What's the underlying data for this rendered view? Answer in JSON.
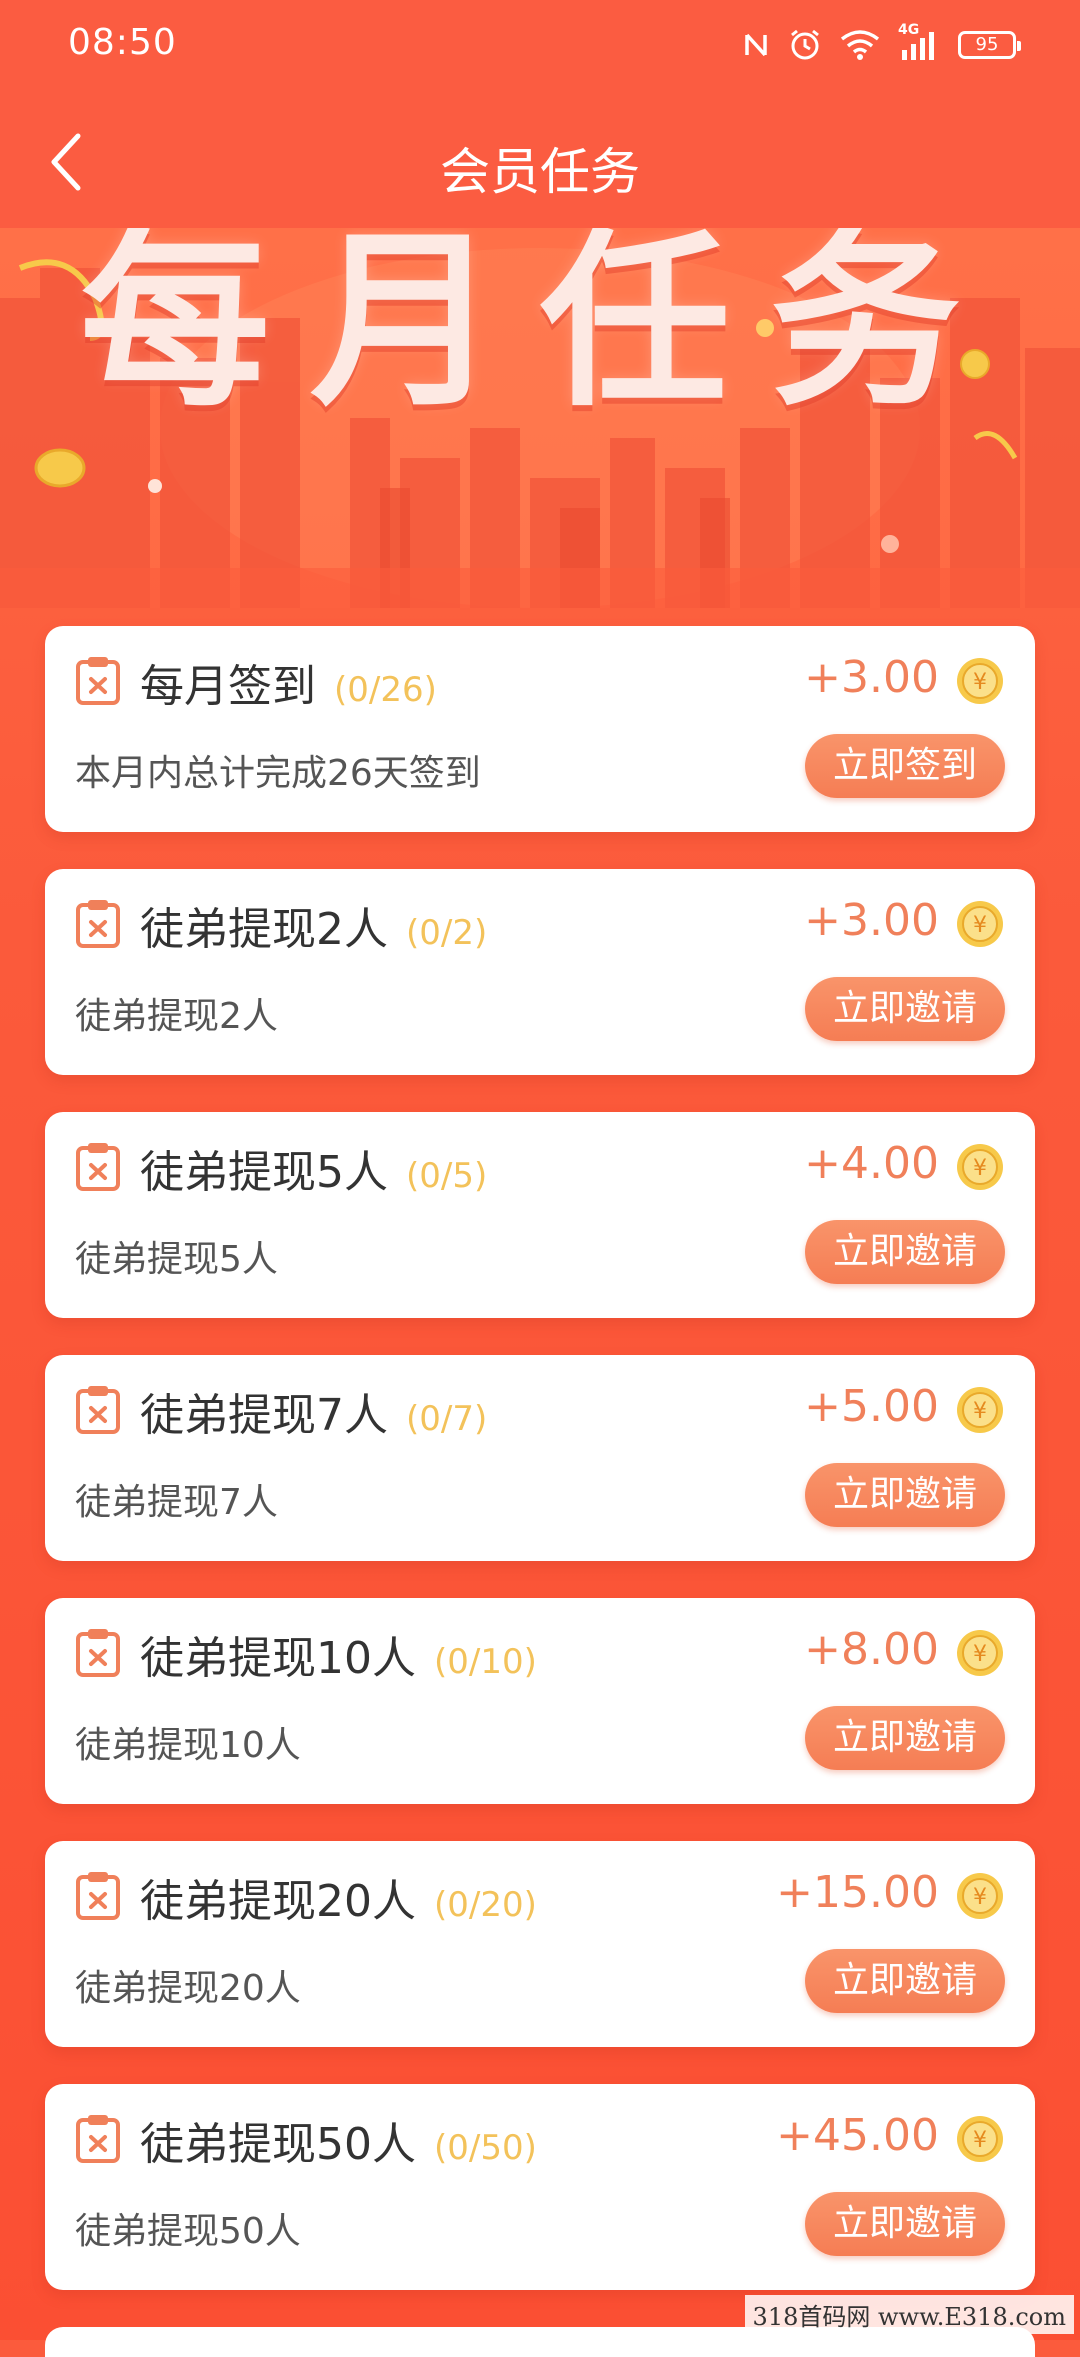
{
  "status_bar": {
    "time": "08:50",
    "network": "4G",
    "battery": "95",
    "icons": [
      "nfc-icon",
      "alarm-icon",
      "wifi-icon",
      "signal-icon",
      "battery-icon"
    ]
  },
  "nav": {
    "title": "会员任务",
    "back_icon": "chevron-left-icon"
  },
  "banner": {
    "title": "每月任务"
  },
  "tasks": [
    {
      "title": "每月签到",
      "progress": "(0/26)",
      "reward": "+3.00",
      "desc": "本月内总计完成26天签到",
      "button": "立即签到"
    },
    {
      "title": "徒弟提现2人",
      "progress": "(0/2)",
      "reward": "+3.00",
      "desc": "徒弟提现2人",
      "button": "立即邀请"
    },
    {
      "title": "徒弟提现5人",
      "progress": "(0/5)",
      "reward": "+4.00",
      "desc": "徒弟提现5人",
      "button": "立即邀请"
    },
    {
      "title": "徒弟提现7人",
      "progress": "(0/7)",
      "reward": "+5.00",
      "desc": "徒弟提现7人",
      "button": "立即邀请"
    },
    {
      "title": "徒弟提现10人",
      "progress": "(0/10)",
      "reward": "+8.00",
      "desc": "徒弟提现10人",
      "button": "立即邀请"
    },
    {
      "title": "徒弟提现20人",
      "progress": "(0/20)",
      "reward": "+15.00",
      "desc": "徒弟提现20人",
      "button": "立即邀请"
    },
    {
      "title": "徒弟提现50人",
      "progress": "(0/50)",
      "reward": "+45.00",
      "desc": "徒弟提现50人",
      "button": "立即邀请"
    }
  ],
  "coin_symbol": "¥",
  "watermark": "318首码网 www.E318.com",
  "colors": {
    "primary": "#fb5c41",
    "reward": "#f0805a",
    "progress": "#f3c25a",
    "button": "#f57d54"
  }
}
